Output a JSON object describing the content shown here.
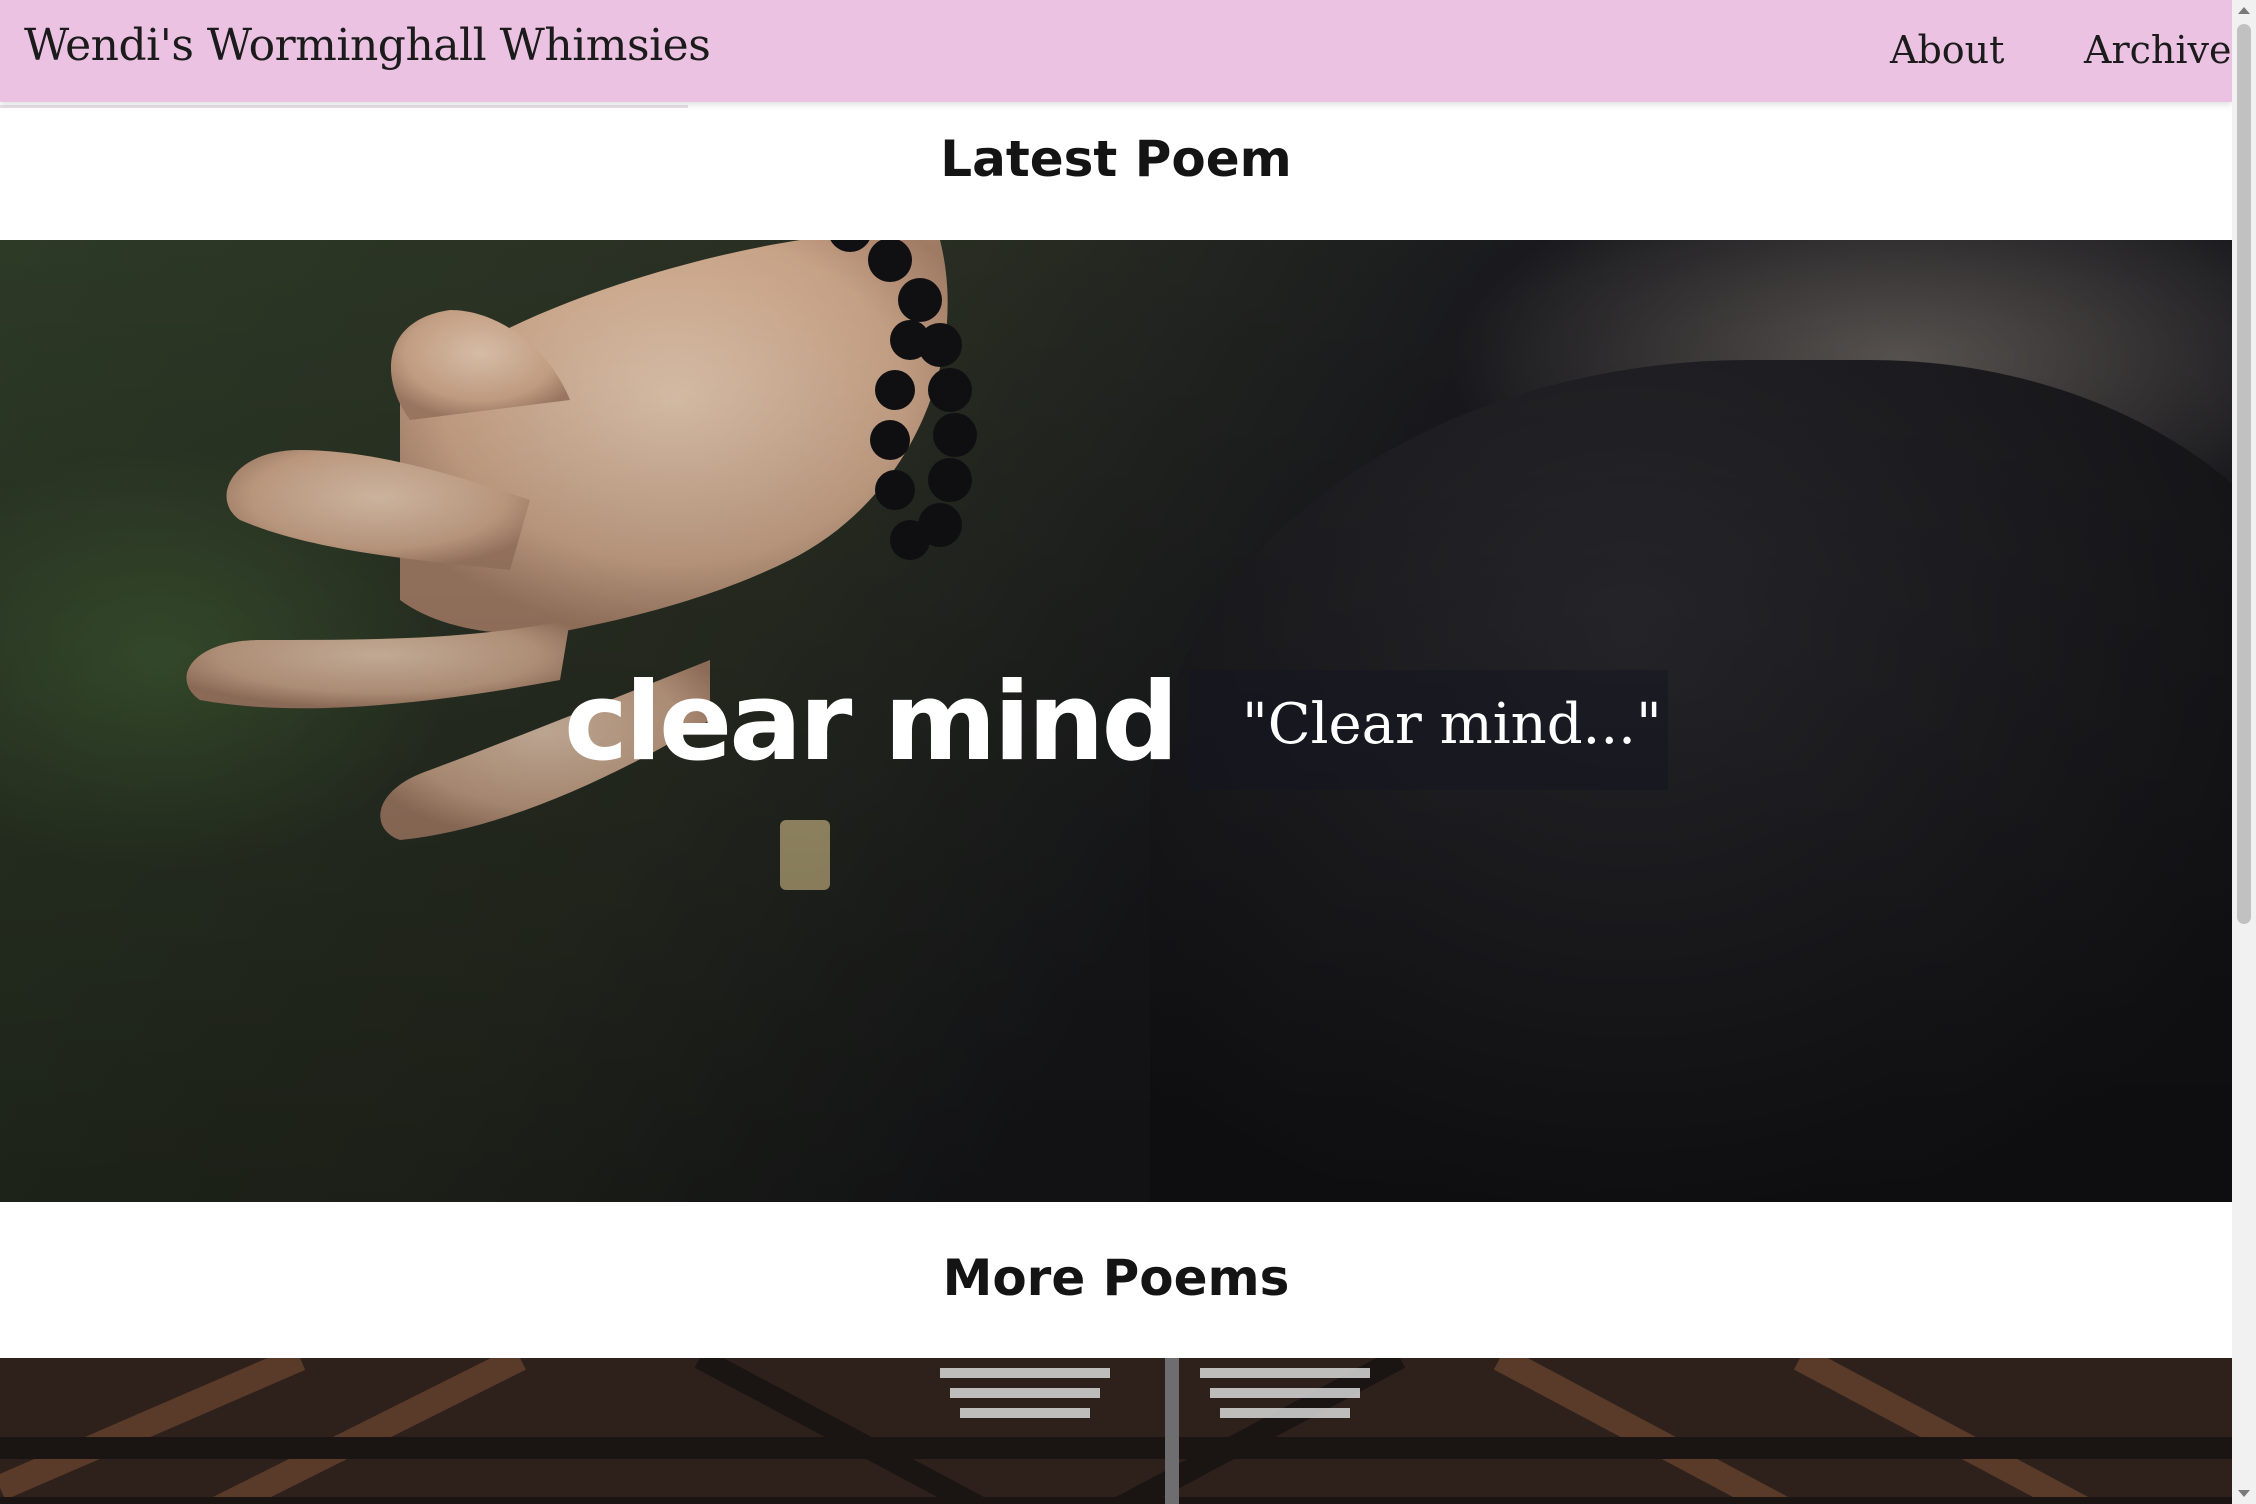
{
  "header": {
    "site_title": "Wendi's Worminghall Whimsies",
    "nav": {
      "about": "About",
      "archive": "Archive"
    },
    "background": "#ecc2e2"
  },
  "latest": {
    "heading": "Latest Poem",
    "poem_title": "clear mind",
    "excerpt": "\"Clear mind...\""
  },
  "more": {
    "heading": "More Poems"
  }
}
